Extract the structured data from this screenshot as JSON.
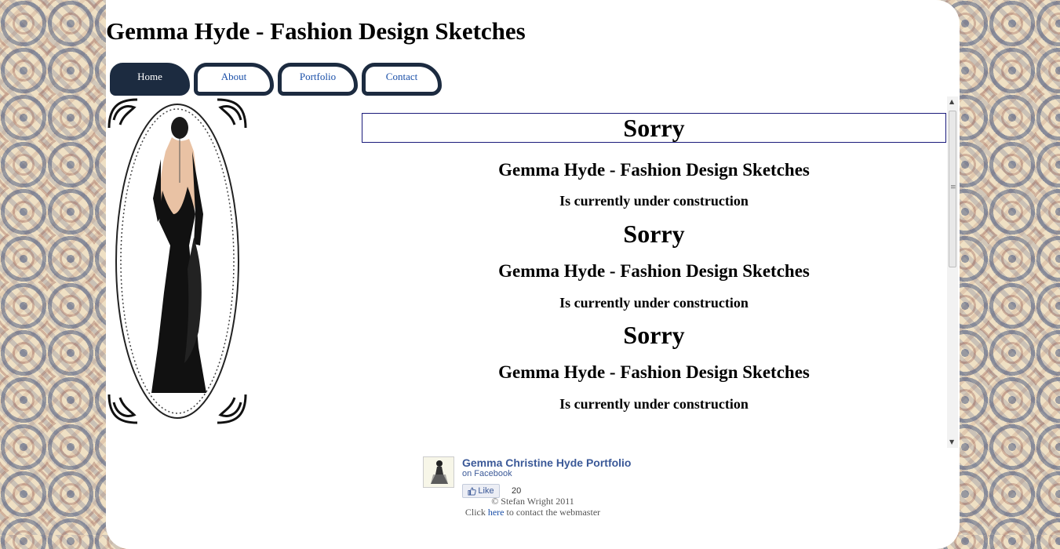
{
  "site": {
    "title": "Gemma Hyde - Fashion Design Sketches"
  },
  "nav": {
    "items": [
      {
        "label": "Home"
      },
      {
        "label": "About"
      },
      {
        "label": "Portfolio"
      },
      {
        "label": "Contact"
      }
    ]
  },
  "content": {
    "blocks": [
      {
        "heading": "Sorry",
        "subheading": "Gemma Hyde - Fashion Design Sketches",
        "text": "Is currently under construction"
      },
      {
        "heading": "Sorry",
        "subheading": "Gemma Hyde - Fashion Design Sketches",
        "text": "Is currently under construction"
      },
      {
        "heading": "Sorry",
        "subheading": "Gemma Hyde - Fashion Design Sketches",
        "text": "Is currently under construction"
      }
    ]
  },
  "facebook": {
    "page_name": "Gemma Christine Hyde Portfolio",
    "sub": "on Facebook",
    "like_label": "Like",
    "like_count": "20"
  },
  "footer": {
    "copyright": "© Stefan Wright 2011",
    "contact_prefix": "Click",
    "contact_link": "here",
    "contact_suffix": "to contact the webmaster"
  },
  "colors": {
    "nav_dark": "#1c2b40",
    "link": "#1a4fa8",
    "facebook": "#3b5998"
  },
  "icons": {
    "scroll_up": "triangle-up-icon",
    "scroll_down": "triangle-down-icon",
    "like": "thumbs-up-icon"
  }
}
